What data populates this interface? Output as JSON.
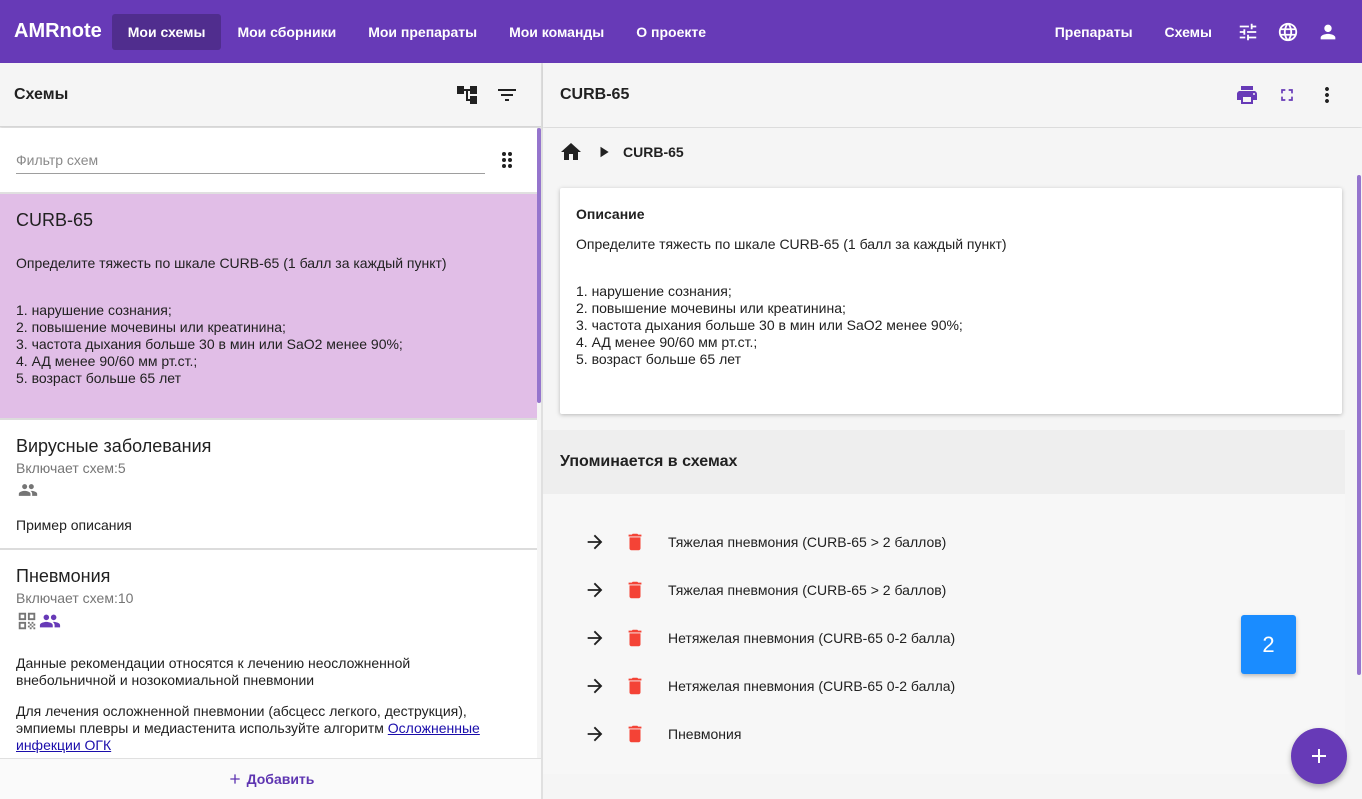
{
  "app": {
    "brand": "AMRnote",
    "nav": [
      "Мои схемы",
      "Мои сборники",
      "Мои препараты",
      "Мои команды",
      "О проекте"
    ],
    "nav_right": [
      "Препараты",
      "Схемы"
    ]
  },
  "left": {
    "title": "Схемы",
    "filter_placeholder": "Фильтр схем",
    "cards": [
      {
        "title": "CURB-65",
        "intro": "Определите тяжесть по шкале CURB-65 (1 балл за каждый пункт)",
        "lines": [
          "1. нарушение сознания;",
          "2. повышение мочевины или креатинина;",
          "3. частота дыхания больше 30 в мин или SaO2 менее 90%;",
          "4. АД менее 90/60 мм рт.ст.;",
          "5. возраст больше 65 лет"
        ]
      },
      {
        "title": "Вирусные заболевания",
        "subtitle": "Включает схем:5",
        "desc": "Пример описания"
      },
      {
        "title": "Пневмония",
        "subtitle": "Включает схем:10",
        "desc1_line1": "Данные рекомендации относятся к лечению неосложненной",
        "desc1_line2": "внебольничной и нозокомиальной пневмонии",
        "desc2_line1": "Для лечения осложненной пневмонии (абсцесс легкого, деструкция),",
        "desc2_line2a": "эмпиемы плевры и медиастенита используйте алгоритм ",
        "desc2_link1": "Осложненные",
        "desc2_link2": "инфекции ОГК"
      }
    ],
    "add_label": "Добавить"
  },
  "right": {
    "title": "CURB-65",
    "breadcrumb": "CURB-65",
    "desc_heading": "Описание",
    "desc_intro": "Определите тяжесть по шкале CURB-65 (1 балл за каждый пункт)",
    "desc_lines": [
      "1. нарушение сознания;",
      "2. повышение мочевины или креатинина;",
      "3. частота дыхания больше 30 в мин или SaO2 менее 90%;",
      "4. АД менее 90/60 мм рт.ст.;",
      "5. возраст больше 65 лет"
    ],
    "mention_heading": "Упоминается в схемах",
    "mentions": [
      "Тяжелая пневмония (CURB-65 > 2 баллов)",
      "Тяжелая пневмония (CURB-65 > 2 баллов)",
      "Нетяжелая пневмония (CURB-65 0-2 балла)",
      "Нетяжелая пневмония (CURB-65 0-2 балла)",
      "Пневмония"
    ],
    "badge": "2"
  },
  "colors": {
    "primary": "#673ab7",
    "selected_card": "#e1bee7",
    "trash": "#f44336",
    "badge": "#1a8cff"
  }
}
